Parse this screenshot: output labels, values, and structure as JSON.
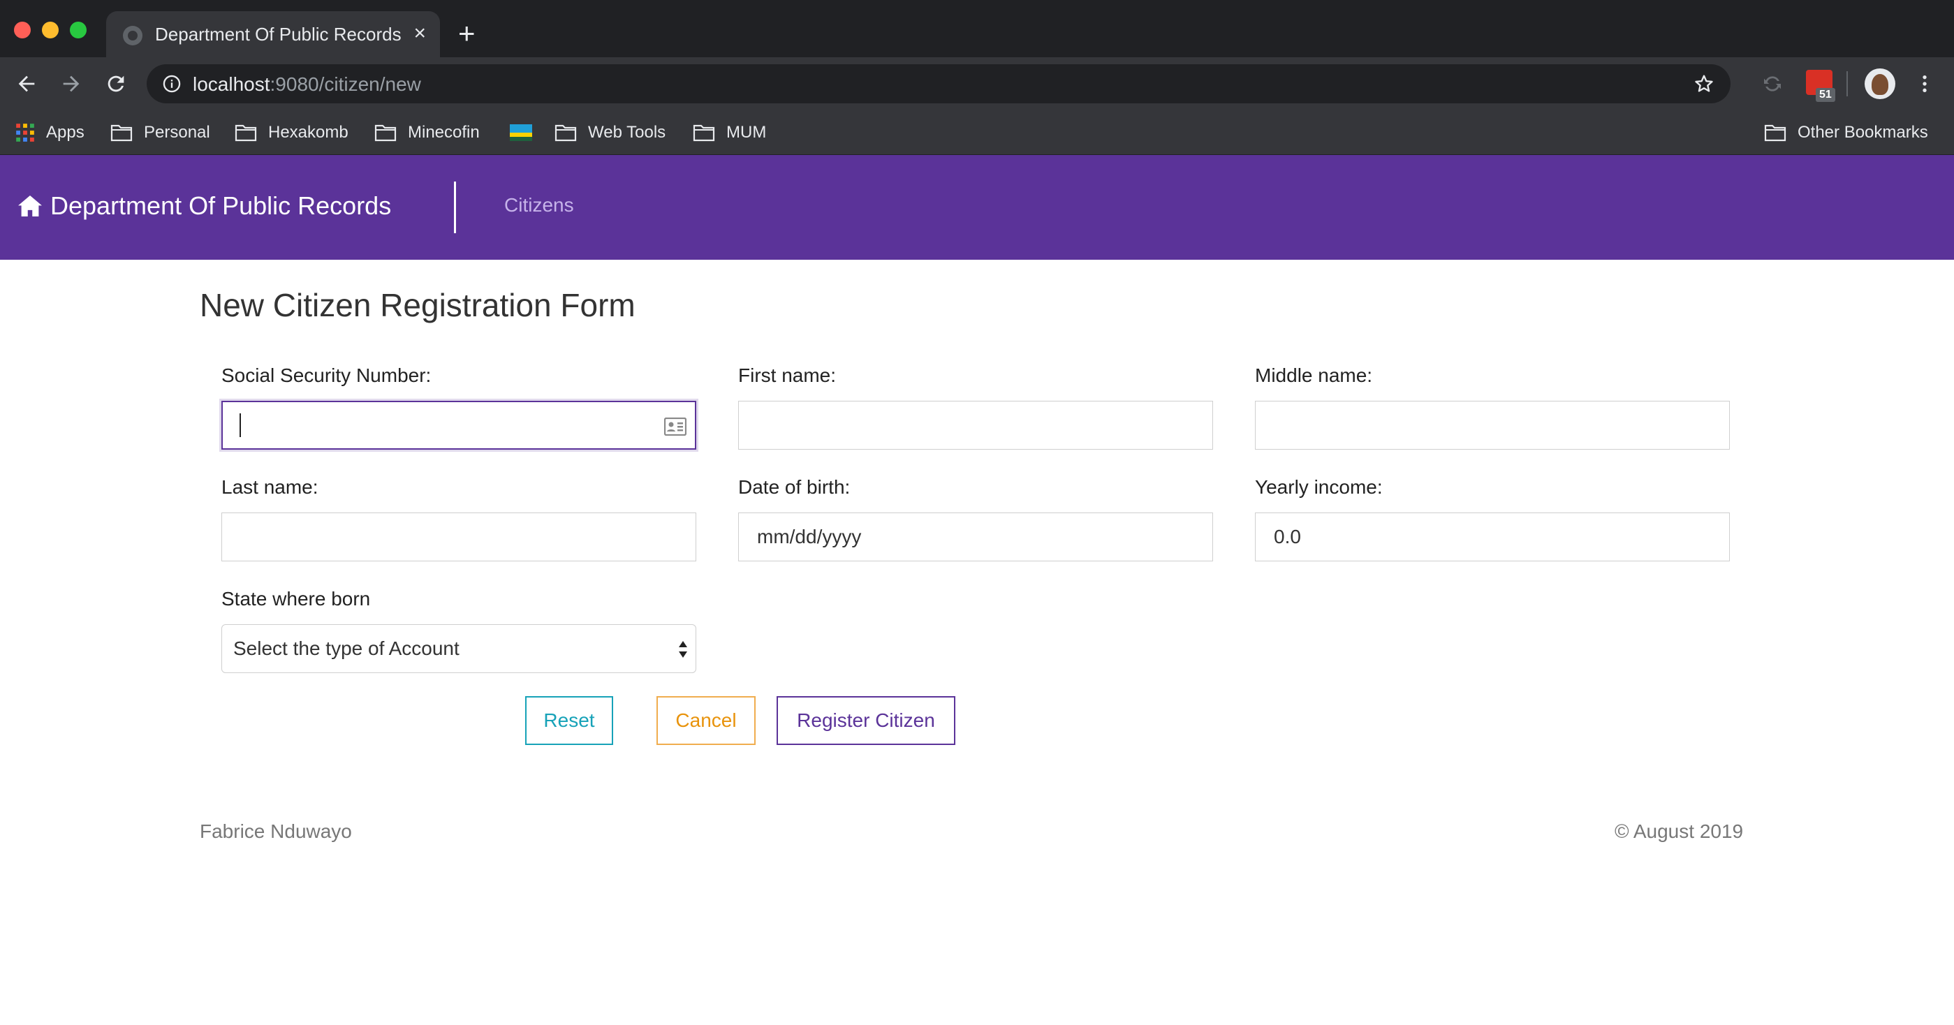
{
  "browser": {
    "tab_title": "Department Of Public Records",
    "tab_close": "×",
    "new_tab": "+",
    "url_host": "localhost",
    "url_path": ":9080/citizen/new",
    "extension_badge_count": "51",
    "bookmarks": [
      "Apps",
      "Personal",
      "Hexakomb",
      "Minecofin",
      "Web Tools",
      "MUM"
    ],
    "other_bookmarks": "Other Bookmarks"
  },
  "navbar": {
    "brand": "Department Of Public Records",
    "links": [
      "Citizens"
    ]
  },
  "form": {
    "title": "New Citizen Registration Form",
    "fields": {
      "ssn": {
        "label": "Social Security Number:",
        "value": ""
      },
      "first_name": {
        "label": "First name:",
        "value": ""
      },
      "middle_name": {
        "label": "Middle name:",
        "value": ""
      },
      "last_name": {
        "label": "Last name:",
        "value": ""
      },
      "dob": {
        "label": "Date of birth:",
        "placeholder": "mm/dd/yyyy"
      },
      "income": {
        "label": "Yearly income:",
        "value": "0.0"
      },
      "state": {
        "label": "State where born",
        "selected": "Select the type of Account"
      }
    },
    "buttons": {
      "reset": "Reset",
      "cancel": "Cancel",
      "register": "Register Citizen"
    }
  },
  "footer": {
    "author": "Fabrice Nduwayo",
    "copyright": "© August 2019"
  },
  "colors": {
    "navbar_bg": "#5b3399",
    "reset": "#17a2b8",
    "cancel": "#f0ad4e",
    "register": "#5b3399"
  }
}
